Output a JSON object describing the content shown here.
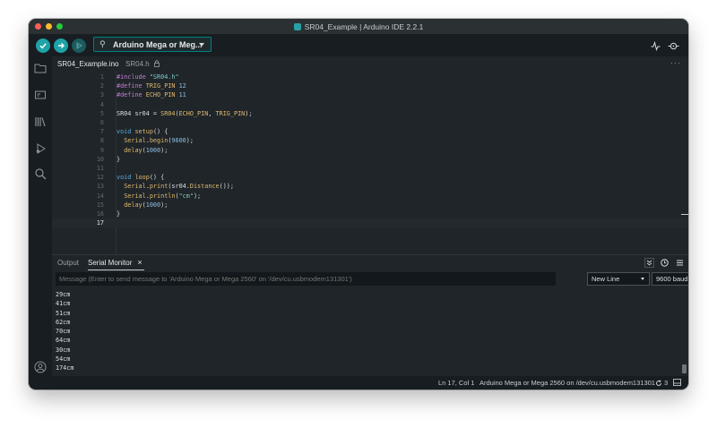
{
  "window": {
    "title": "SR04_Example | Arduino IDE 2.2.1"
  },
  "toolbar": {
    "board": "Arduino Mega or Meg...",
    "icons": [
      "verify-icon",
      "upload-icon",
      "debug-icon",
      "usb-icon",
      "serial-plotter-icon",
      "serial-monitor-icon"
    ]
  },
  "tabs": {
    "items": [
      {
        "label": "SR04_Example.ino"
      },
      {
        "label": "SR04.h"
      }
    ],
    "more": "···"
  },
  "editor": {
    "lines": [
      {
        "n": "1",
        "code": "#include \"SR04.h\""
      },
      {
        "n": "2",
        "code": "#define TRIG_PIN 12"
      },
      {
        "n": "3",
        "code": "#define ECHO_PIN 11"
      },
      {
        "n": "4",
        "code": ""
      },
      {
        "n": "5",
        "code": "SR04 sr04 = SR04(ECHO_PIN, TRIG_PIN);"
      },
      {
        "n": "6",
        "code": ""
      },
      {
        "n": "7",
        "code": "void setup() {"
      },
      {
        "n": "8",
        "code": "  Serial.begin(9600);"
      },
      {
        "n": "9",
        "code": "  delay(1000);"
      },
      {
        "n": "10",
        "code": "}"
      },
      {
        "n": "11",
        "code": ""
      },
      {
        "n": "12",
        "code": "void loop() {"
      },
      {
        "n": "13",
        "code": "  Serial.print(sr04.Distance());"
      },
      {
        "n": "14",
        "code": "  Serial.println(\"cm\");"
      },
      {
        "n": "15",
        "code": "  delay(1000);"
      },
      {
        "n": "16",
        "code": "}"
      },
      {
        "n": "17",
        "code": ""
      }
    ],
    "current_line": "17"
  },
  "bottom": {
    "tabs": [
      {
        "label": "Output"
      },
      {
        "label": "Serial Monitor"
      }
    ],
    "close": "×",
    "message_placeholder": "Message (Enter to send message to 'Arduino Mega or Mega 2560' on '/dev/cu.usbmodem131301')",
    "line_ending": "New Line",
    "baud": "9600 baud",
    "monitor_lines": [
      "29cm",
      "41cm",
      "51cm",
      "62cm",
      "70cm",
      "64cm",
      "30cm",
      "54cm",
      "174cm"
    ]
  },
  "status": {
    "position": "Ln 17, Col 1",
    "board_port": "Arduino Mega or Mega 2560 on /dev/cu.usbmodem131301",
    "notifications": "3"
  },
  "colors": {
    "accent": "#008184",
    "background": "#1f2529",
    "toolbar": "#171d21"
  }
}
